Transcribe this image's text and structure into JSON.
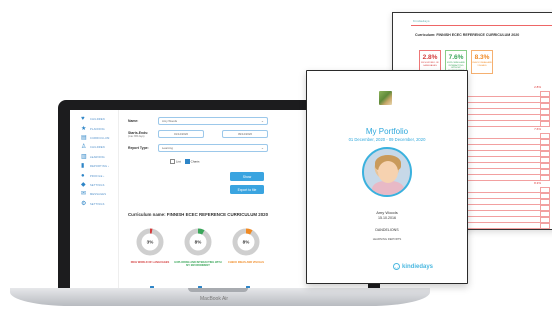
{
  "colors": {
    "accent": "#2fa8dc",
    "sidebar_icon": "#2e85c7",
    "button": "#3aa4e0",
    "red": "#d33b3b",
    "green": "#3aa65a",
    "orange": "#f08a24"
  },
  "back_doc": {
    "header": "Kindiedays",
    "curriculum": "Curriculum: FINNISH ECEC REFERENCE CURRICULUM 2020",
    "stats": [
      {
        "value": "2.8%",
        "label": "RICH WORLD OF LANGUAGES",
        "color": "#d33b3b"
      },
      {
        "value": "7.6%",
        "label": "EXPLORING AND INTERACTING WITH MY ENVIRONMENT",
        "color": "#3aa65a"
      },
      {
        "value": "8.3%",
        "label": "CHECK IDEAS AND VISUALS",
        "color": "#f08a24"
      }
    ],
    "section_values": [
      "2.8%",
      "7.6%",
      "8.3%"
    ]
  },
  "app": {
    "sidebar": [
      {
        "icon": "heart-icon",
        "glyph": "♥",
        "label": "Children"
      },
      {
        "icon": "star-icon",
        "glyph": "★",
        "label": "Planning"
      },
      {
        "icon": "file-icon",
        "glyph": "▤",
        "label": "Curriculum"
      },
      {
        "icon": "person-icon",
        "glyph": "♙",
        "label": "Children"
      },
      {
        "icon": "book-icon",
        "glyph": "▥",
        "label": "Learning"
      },
      {
        "icon": "chart-icon",
        "glyph": "▮",
        "label": "Reporting ›"
      },
      {
        "icon": "user-icon",
        "glyph": "●",
        "label": "Profile ›"
      },
      {
        "icon": "gear-icon",
        "glyph": "◆",
        "label": "Settings"
      },
      {
        "icon": "mail-icon",
        "glyph": "✉",
        "label": "Messages"
      },
      {
        "icon": "settings-icon",
        "glyph": "⚙",
        "label": "Settings"
      }
    ],
    "form": {
      "name_label": "Name:",
      "name_value": "Amy Woods",
      "starts_label": "Starts-Ends:",
      "starts_sub": "(max 365 days)",
      "start_date": "01/12/2020",
      "end_date": "09/12/2020",
      "report_type_label": "Report Type:",
      "report_type_value": "Learning",
      "check_list": "List",
      "check_charts": "Charts",
      "show_button": "Show",
      "export_button": "Export to file"
    },
    "curriculum_name": "Curriculum name: FINNISH ECEC REFERENCE CURRICULUM 2020",
    "donuts": [
      {
        "value": "3%",
        "pct": 0.03,
        "color": "#d33b3b",
        "label": "RICH WORLD OF LANGUAGES"
      },
      {
        "value": "8%",
        "pct": 0.08,
        "color": "#3aa65a",
        "label": "EXPLORING AND INTERACTING WITH MY ENVIRONMENT"
      },
      {
        "value": "8%",
        "pct": 0.08,
        "color": "#f08a24",
        "label": "CHECK IDEAS AND VISUALS"
      }
    ]
  },
  "laptop": {
    "label": "MacBook Air"
  },
  "portfolio": {
    "title": "My Portfolio",
    "dates": "01 December, 2020 - 09 December, 2020",
    "child_name": "Amy Woods",
    "dob": "15.10.2016",
    "group": "DANDELIONS",
    "report": "LEARNING REPORTS",
    "brand": "kindiedays"
  }
}
